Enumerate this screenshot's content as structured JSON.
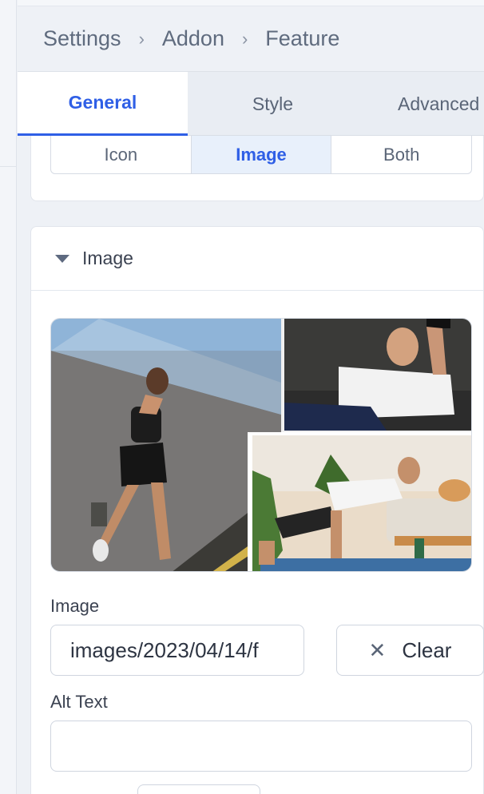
{
  "breadcrumb": {
    "items": [
      "Settings",
      "Addon",
      "Feature"
    ],
    "separator": "›"
  },
  "tabs": [
    {
      "label": "General",
      "active": true
    },
    {
      "label": "Style",
      "active": false
    },
    {
      "label": "Advanced",
      "active": false
    }
  ],
  "media_type": {
    "options": [
      "Icon",
      "Image",
      "Both"
    ],
    "selected": "Image"
  },
  "image_section": {
    "title": "Image",
    "image_label": "Image",
    "image_value": "images/2023/04/14/f",
    "clear_label": "Clear",
    "alt_label": "Alt Text",
    "alt_value": ""
  },
  "colors": {
    "accent": "#2f5fe6",
    "panel_bg": "#eef1f6"
  }
}
